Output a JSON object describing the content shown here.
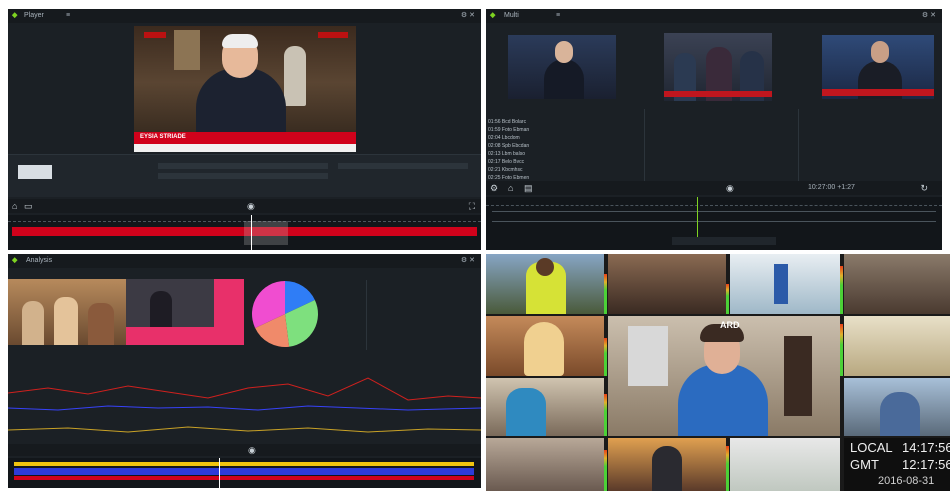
{
  "q1": {
    "title": "Player",
    "lower_third_name": "EYSIA STRIADE"
  },
  "q2": {
    "title": "Multi",
    "timecode": "10:27:00 +1:27",
    "rows": [
      "01:56 Bcd Bolarc",
      "01:59 Foto Ebman",
      "02:04 Lbcdom",
      "02:08 Spb Ebcdan",
      "02:13 Lbm balso",
      "02:17 Belo Bvcc",
      "02:21 Kbcmhsc",
      "02:25 Foto Ebmen",
      "02:30 Bvbobv Mvv"
    ]
  },
  "q3": {
    "title": "Analysis",
    "pie_slices": [
      {
        "color": "#2f7df6",
        "value": 18
      },
      {
        "color": "#7ee07e",
        "value": 30
      },
      {
        "color": "#f08a6a",
        "value": 20
      },
      {
        "color": "#f04dd0",
        "value": 32
      }
    ]
  },
  "q4": {
    "local_label": "LOCAL",
    "local_time": "14:17:56",
    "gmt_label": "GMT",
    "gmt_time": "12:17:56",
    "date": "2016-08-31",
    "tile_label": "ARD"
  },
  "icons": {
    "play": "play-icon",
    "home": "home-icon",
    "gear": "gear-icon",
    "fullscreen": "fullscreen-icon"
  }
}
